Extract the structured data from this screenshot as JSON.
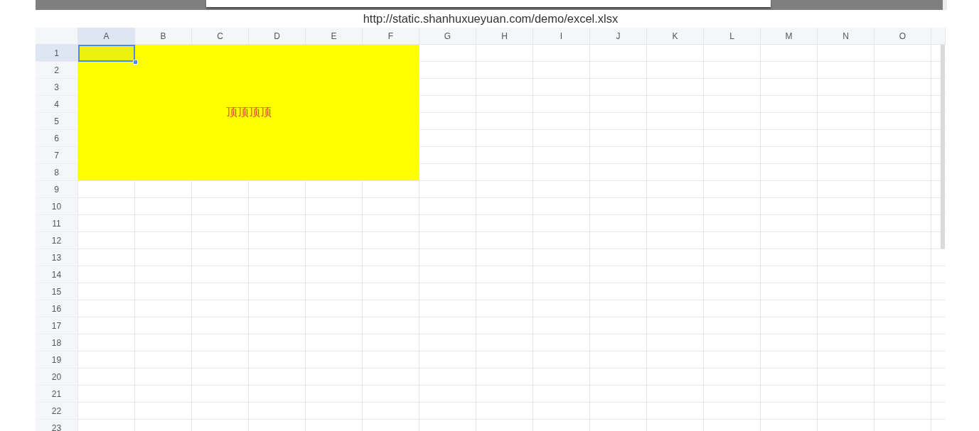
{
  "file_url": "http://static.shanhuxueyuan.com/demo/excel.xlsx",
  "sheet": {
    "columns": [
      {
        "label": "A",
        "selected": true
      },
      {
        "label": "B",
        "selected": false
      },
      {
        "label": "C",
        "selected": false
      },
      {
        "label": "D",
        "selected": false
      },
      {
        "label": "E",
        "selected": false
      },
      {
        "label": "F",
        "selected": false
      },
      {
        "label": "G",
        "selected": false
      },
      {
        "label": "H",
        "selected": false
      },
      {
        "label": "I",
        "selected": false
      },
      {
        "label": "J",
        "selected": false
      },
      {
        "label": "K",
        "selected": false
      },
      {
        "label": "L",
        "selected": false
      },
      {
        "label": "M",
        "selected": false
      },
      {
        "label": "N",
        "selected": false
      },
      {
        "label": "O",
        "selected": false
      }
    ],
    "rows": [
      {
        "label": "1",
        "selected": true
      },
      {
        "label": "2",
        "selected": false
      },
      {
        "label": "3",
        "selected": false
      },
      {
        "label": "4",
        "selected": false
      },
      {
        "label": "5",
        "selected": false
      },
      {
        "label": "6",
        "selected": false
      },
      {
        "label": "7",
        "selected": false
      },
      {
        "label": "8",
        "selected": false
      },
      {
        "label": "9",
        "selected": false
      },
      {
        "label": "10",
        "selected": false
      },
      {
        "label": "11",
        "selected": false
      },
      {
        "label": "12",
        "selected": false
      },
      {
        "label": "13",
        "selected": false
      },
      {
        "label": "14",
        "selected": false
      },
      {
        "label": "15",
        "selected": false
      },
      {
        "label": "16",
        "selected": false
      },
      {
        "label": "17",
        "selected": false
      },
      {
        "label": "18",
        "selected": false
      },
      {
        "label": "19",
        "selected": false
      },
      {
        "label": "20",
        "selected": false
      },
      {
        "label": "21",
        "selected": false
      },
      {
        "label": "22",
        "selected": false
      },
      {
        "label": "23",
        "selected": false
      }
    ],
    "merged_cell": {
      "text": "顶顶顶顶"
    }
  }
}
